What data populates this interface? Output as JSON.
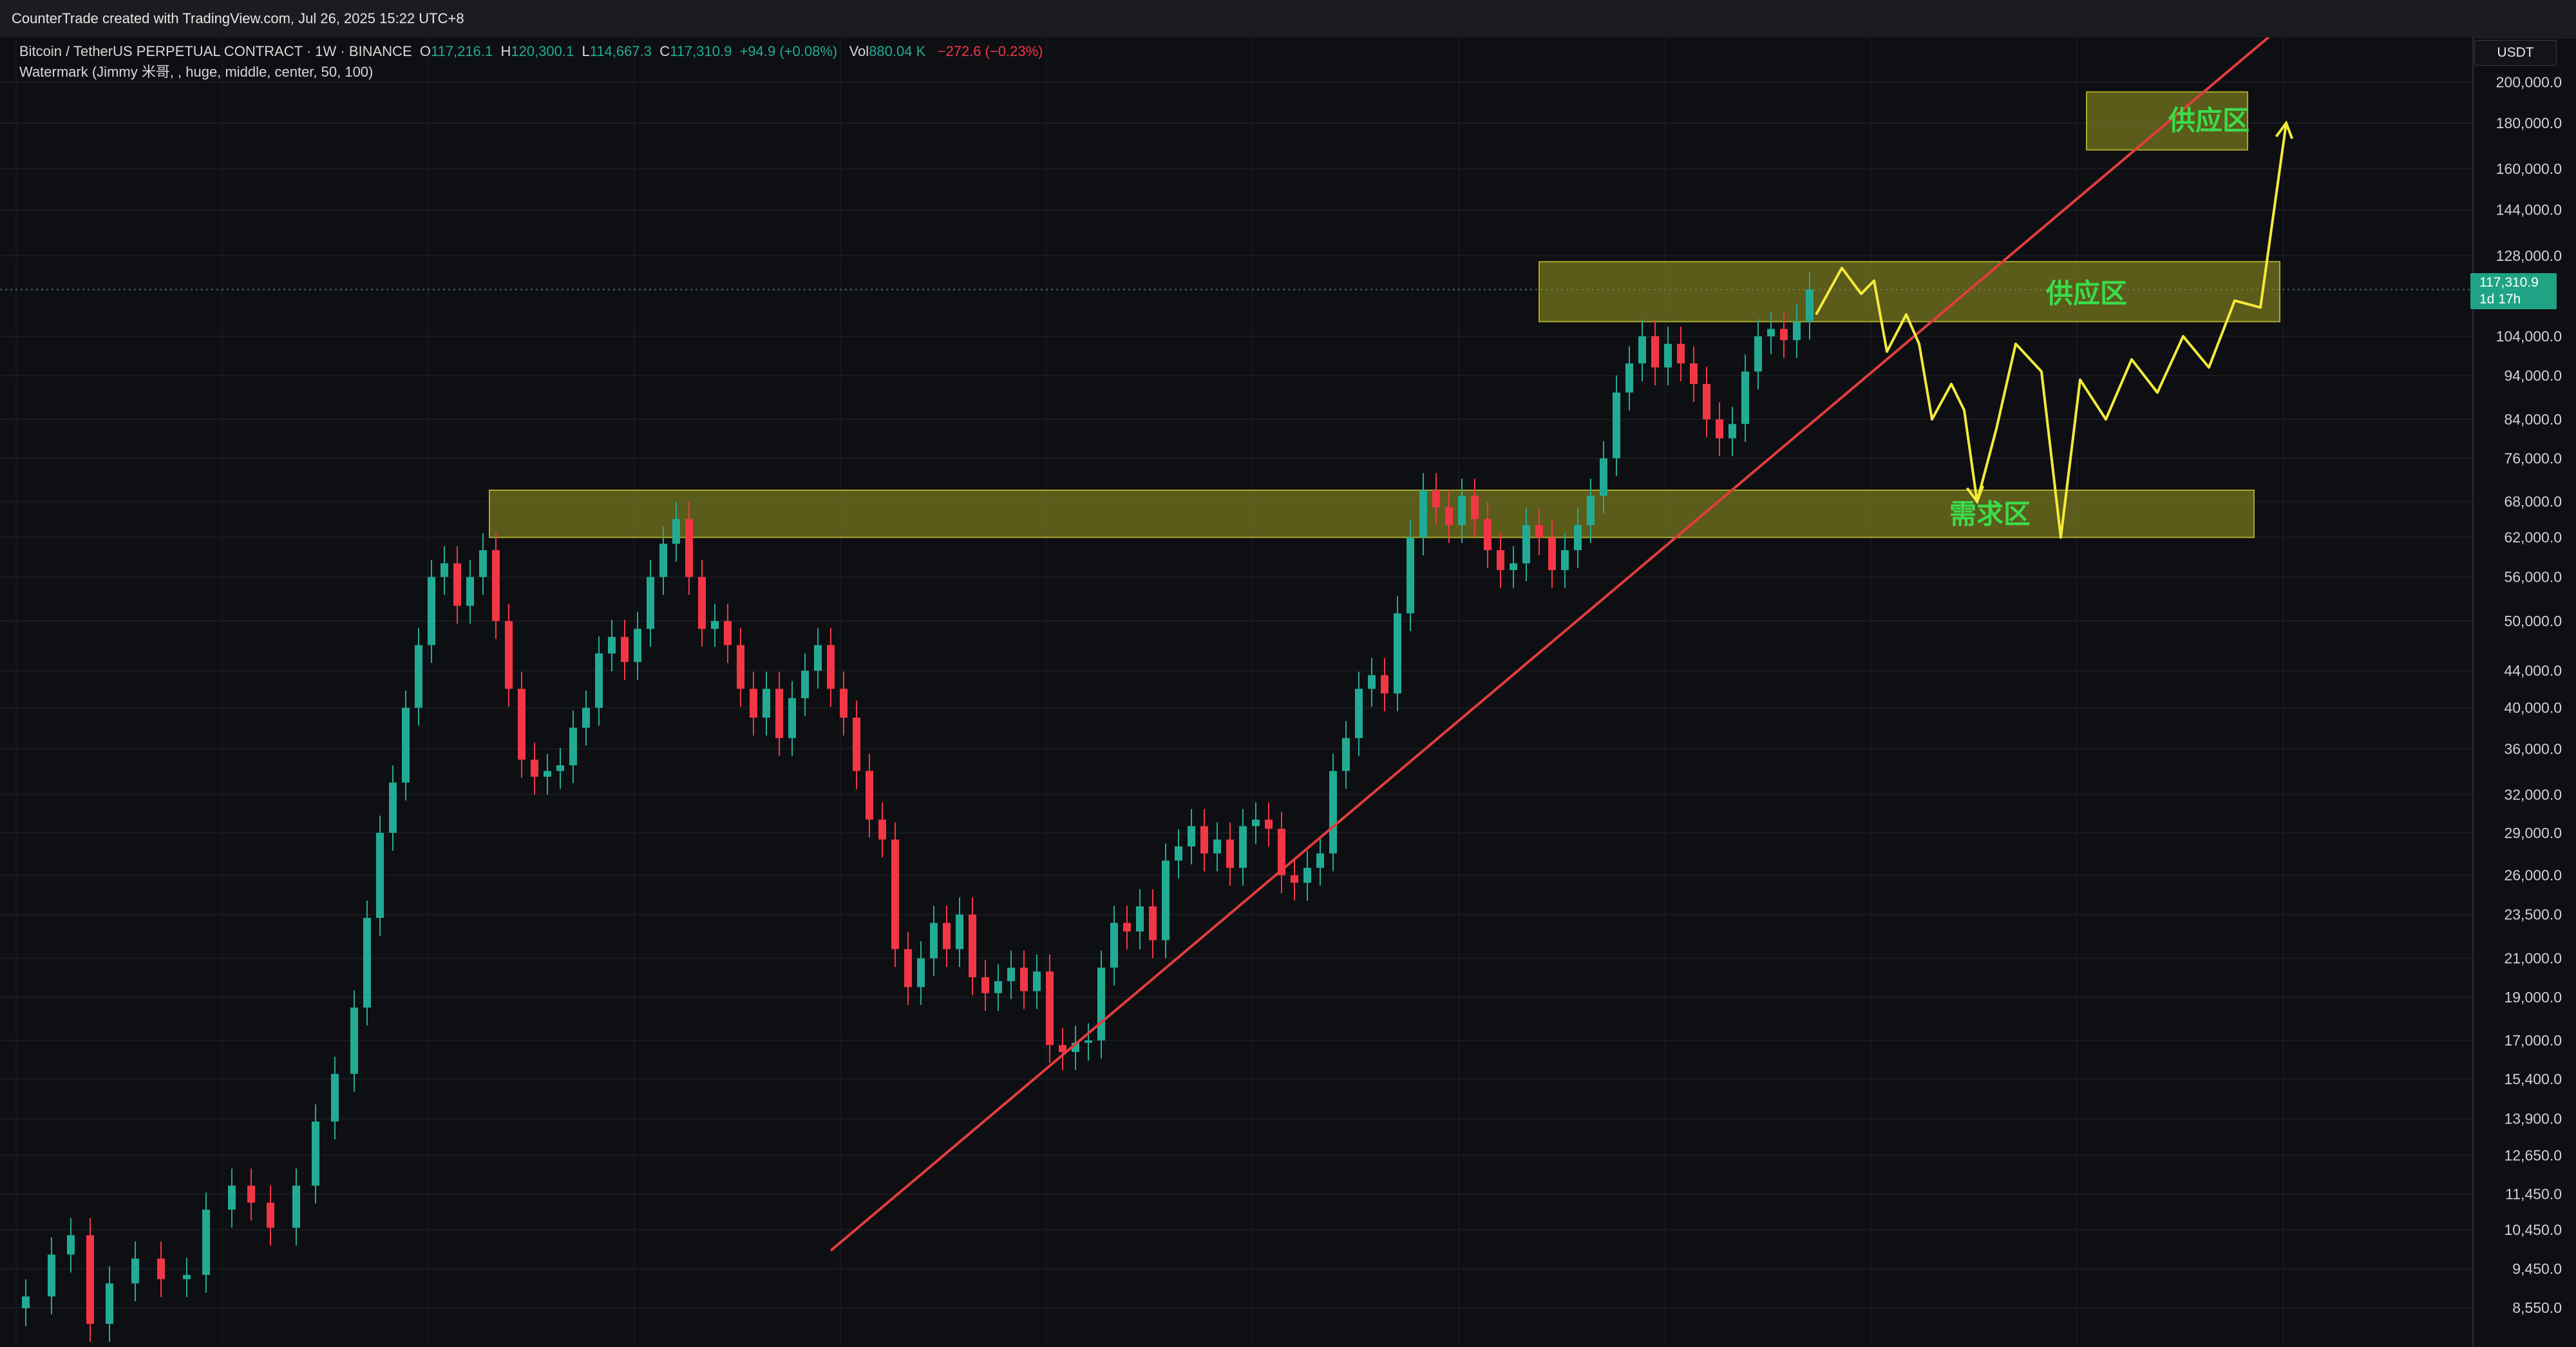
{
  "header": {
    "credit": "CounterTrade created with TradingView.com, Jul 26, 2025 15:22 UTC+8"
  },
  "legend": {
    "symbol": "Bitcoin / TetherUS PERPETUAL CONTRACT · 1W · BINANCE",
    "o_label": "O",
    "o_value": "117,216.1",
    "h_label": "H",
    "h_value": "120,300.1",
    "l_label": "L",
    "l_value": "114,667.3",
    "c_label": "C",
    "c_value": "117,310.9",
    "change": "+94.9 (+0.08%)",
    "vol_label": "Vol",
    "vol_value": "880.04 K",
    "vol_change": "−272.6 (−0.23%)",
    "watermark": "Watermark (Jimmy 米哥, , huge, middle, center, 50, 100)"
  },
  "axis": {
    "currency": "USDT",
    "last_price": "117,310.9",
    "countdown": "1d 17h"
  },
  "colors": {
    "up": "#22ab94",
    "down": "#f23645",
    "zone_fill": "#8a8a1e",
    "zone_label": "#3bdc4a",
    "trendline": "#e33d3d",
    "projection": "#f2ea3a"
  },
  "chart_data": {
    "type": "candlestick",
    "scale": "log",
    "y_range": [
      8000,
      210000
    ],
    "y_ticks": [
      "200,000.0",
      "180,000.0",
      "160,000.0",
      "144,000.0",
      "128,000.0",
      "104,000.0",
      "94,000.0",
      "84,000.0",
      "76,000.0",
      "68,000.0",
      "62,000.0",
      "56,000.0",
      "50,000.0",
      "44,000.0",
      "40,000.0",
      "36,000.0",
      "32,000.0",
      "29,000.0",
      "26,000.0",
      "23,500.0",
      "21,000.0",
      "19,000.0",
      "17,000.0",
      "15,400.0",
      "13,900.0",
      "12,650.0",
      "11,450.0",
      "10,450.0",
      "9,450.0",
      "8,550.0"
    ],
    "y_tick_values": [
      200000,
      180000,
      160000,
      144000,
      128000,
      104000,
      94000,
      84000,
      76000,
      68000,
      62000,
      56000,
      50000,
      44000,
      40000,
      36000,
      32000,
      29000,
      26000,
      23500,
      21000,
      19000,
      17000,
      15400,
      13900,
      12650,
      11450,
      10450,
      9450,
      8550
    ],
    "candles": [
      {
        "t": 0,
        "p": 8800
      },
      {
        "t": 4,
        "p": 9800
      },
      {
        "t": 7,
        "p": 10300
      },
      {
        "t": 10,
        "p": 8200
      },
      {
        "t": 13,
        "p": 9100
      },
      {
        "t": 17,
        "p": 9700
      },
      {
        "t": 21,
        "p": 9200
      },
      {
        "t": 25,
        "p": 9300
      },
      {
        "t": 28,
        "p": 11000
      },
      {
        "t": 32,
        "p": 11700
      },
      {
        "t": 35,
        "p": 11200
      },
      {
        "t": 38,
        "p": 10500
      },
      {
        "t": 42,
        "p": 11700
      },
      {
        "t": 45,
        "p": 13800
      },
      {
        "t": 48,
        "p": 15600
      },
      {
        "t": 51,
        "p": 18500
      },
      {
        "t": 53,
        "p": 23300
      },
      {
        "t": 55,
        "p": 29000
      },
      {
        "t": 57,
        "p": 33000
      },
      {
        "t": 59,
        "p": 40000
      },
      {
        "t": 61,
        "p": 47000
      },
      {
        "t": 63,
        "p": 56000
      },
      {
        "t": 65,
        "p": 58000
      },
      {
        "t": 67,
        "p": 52000
      },
      {
        "t": 69,
        "p": 56000
      },
      {
        "t": 71,
        "p": 60000
      },
      {
        "t": 73,
        "p": 50000
      },
      {
        "t": 75,
        "p": 42000
      },
      {
        "t": 77,
        "p": 35000
      },
      {
        "t": 79,
        "p": 33500
      },
      {
        "t": 81,
        "p": 34000
      },
      {
        "t": 83,
        "p": 34500
      },
      {
        "t": 85,
        "p": 38000
      },
      {
        "t": 87,
        "p": 40000
      },
      {
        "t": 89,
        "p": 46000
      },
      {
        "t": 91,
        "p": 48000
      },
      {
        "t": 93,
        "p": 45000
      },
      {
        "t": 95,
        "p": 49000
      },
      {
        "t": 97,
        "p": 56000
      },
      {
        "t": 99,
        "p": 61000
      },
      {
        "t": 101,
        "p": 65000
      },
      {
        "t": 103,
        "p": 56000
      },
      {
        "t": 105,
        "p": 49000
      },
      {
        "t": 107,
        "p": 50000
      },
      {
        "t": 109,
        "p": 47000
      },
      {
        "t": 111,
        "p": 42000
      },
      {
        "t": 113,
        "p": 39000
      },
      {
        "t": 115,
        "p": 42000
      },
      {
        "t": 117,
        "p": 37000
      },
      {
        "t": 119,
        "p": 41000
      },
      {
        "t": 121,
        "p": 44000
      },
      {
        "t": 123,
        "p": 47000
      },
      {
        "t": 125,
        "p": 42000
      },
      {
        "t": 127,
        "p": 39000
      },
      {
        "t": 129,
        "p": 34000
      },
      {
        "t": 131,
        "p": 30000
      },
      {
        "t": 133,
        "p": 28500
      },
      {
        "t": 135,
        "p": 21500
      },
      {
        "t": 137,
        "p": 19500
      },
      {
        "t": 139,
        "p": 21000
      },
      {
        "t": 141,
        "p": 23000
      },
      {
        "t": 143,
        "p": 21500
      },
      {
        "t": 145,
        "p": 23500
      },
      {
        "t": 147,
        "p": 20000
      },
      {
        "t": 149,
        "p": 19200
      },
      {
        "t": 151,
        "p": 19800
      },
      {
        "t": 153,
        "p": 20500
      },
      {
        "t": 155,
        "p": 19300
      },
      {
        "t": 157,
        "p": 20300
      },
      {
        "t": 159,
        "p": 16800
      },
      {
        "t": 161,
        "p": 16500
      },
      {
        "t": 163,
        "p": 16900
      },
      {
        "t": 165,
        "p": 17000
      },
      {
        "t": 167,
        "p": 20500
      },
      {
        "t": 169,
        "p": 23000
      },
      {
        "t": 171,
        "p": 22500
      },
      {
        "t": 173,
        "p": 24000
      },
      {
        "t": 175,
        "p": 22000
      },
      {
        "t": 177,
        "p": 27000
      },
      {
        "t": 179,
        "p": 28000
      },
      {
        "t": 181,
        "p": 29500
      },
      {
        "t": 183,
        "p": 27500
      },
      {
        "t": 185,
        "p": 28500
      },
      {
        "t": 187,
        "p": 26500
      },
      {
        "t": 189,
        "p": 29500
      },
      {
        "t": 191,
        "p": 30000
      },
      {
        "t": 193,
        "p": 29300
      },
      {
        "t": 195,
        "p": 26000
      },
      {
        "t": 197,
        "p": 25500
      },
      {
        "t": 199,
        "p": 26500
      },
      {
        "t": 201,
        "p": 27500
      },
      {
        "t": 203,
        "p": 34000
      },
      {
        "t": 205,
        "p": 37000
      },
      {
        "t": 207,
        "p": 42000
      },
      {
        "t": 209,
        "p": 43500
      },
      {
        "t": 211,
        "p": 41500
      },
      {
        "t": 213,
        "p": 51000
      },
      {
        "t": 215,
        "p": 62000
      },
      {
        "t": 217,
        "p": 70000
      },
      {
        "t": 219,
        "p": 67000
      },
      {
        "t": 221,
        "p": 64000
      },
      {
        "t": 223,
        "p": 69000
      },
      {
        "t": 225,
        "p": 65000
      },
      {
        "t": 227,
        "p": 60000
      },
      {
        "t": 229,
        "p": 57000
      },
      {
        "t": 231,
        "p": 58000
      },
      {
        "t": 233,
        "p": 64000
      },
      {
        "t": 235,
        "p": 62000
      },
      {
        "t": 237,
        "p": 57000
      },
      {
        "t": 239,
        "p": 60000
      },
      {
        "t": 241,
        "p": 64000
      },
      {
        "t": 243,
        "p": 69000
      },
      {
        "t": 245,
        "p": 76000
      },
      {
        "t": 247,
        "p": 90000
      },
      {
        "t": 249,
        "p": 97000
      },
      {
        "t": 251,
        "p": 104000
      },
      {
        "t": 253,
        "p": 96000
      },
      {
        "t": 255,
        "p": 102000
      },
      {
        "t": 257,
        "p": 97000
      },
      {
        "t": 259,
        "p": 92000
      },
      {
        "t": 261,
        "p": 84000
      },
      {
        "t": 263,
        "p": 80000
      },
      {
        "t": 265,
        "p": 83000
      },
      {
        "t": 267,
        "p": 95000
      },
      {
        "t": 269,
        "p": 104000
      },
      {
        "t": 271,
        "p": 106000
      },
      {
        "t": 273,
        "p": 103000
      },
      {
        "t": 275,
        "p": 108000
      },
      {
        "t": 277,
        "p": 117300
      }
    ],
    "trendline": [
      {
        "t": 125,
        "p": 9900
      },
      {
        "t": 350,
        "p": 230000
      }
    ],
    "zones": [
      {
        "label": "供应区",
        "t0": 320,
        "t1": 345,
        "p_low": 168000,
        "p_high": 195000
      },
      {
        "label": "供应区",
        "t0": 235,
        "t1": 350,
        "p_low": 108000,
        "p_high": 126000
      },
      {
        "label": "需求区",
        "t0": 72,
        "t1": 346,
        "p_low": 62000,
        "p_high": 70000
      }
    ],
    "projection": [
      {
        "t": 278,
        "p": 110000
      },
      {
        "t": 282,
        "p": 124000
      },
      {
        "t": 285,
        "p": 116000
      },
      {
        "t": 287,
        "p": 120000
      },
      {
        "t": 289,
        "p": 100000
      },
      {
        "t": 292,
        "p": 110000
      },
      {
        "t": 294,
        "p": 102000
      },
      {
        "t": 296,
        "p": 84000
      },
      {
        "t": 299,
        "p": 92000
      },
      {
        "t": 301,
        "p": 86000
      },
      {
        "t": 303,
        "p": 68000
      },
      {
        "t": 306,
        "p": 82000
      },
      {
        "t": 309,
        "p": 102000
      },
      {
        "t": 313,
        "p": 95000
      },
      {
        "t": 316,
        "p": 62000
      },
      {
        "t": 319,
        "p": 93000
      },
      {
        "t": 323,
        "p": 84000
      },
      {
        "t": 327,
        "p": 98000
      },
      {
        "t": 331,
        "p": 90000
      },
      {
        "t": 335,
        "p": 104000
      },
      {
        "t": 339,
        "p": 96000
      },
      {
        "t": 343,
        "p": 114000
      },
      {
        "t": 347,
        "p": 112000
      },
      {
        "t": 351,
        "p": 180000
      }
    ]
  }
}
